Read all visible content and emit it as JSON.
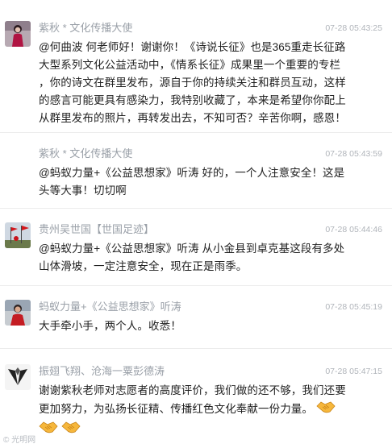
{
  "messages": [
    {
      "name": "紫秋 * 文化传播大使",
      "time": "07-28 05:43:25",
      "avatar": "woman-red-dress-avatar",
      "lines": [
        "@何曲波 何老师好！谢谢你！《诗说长征》也是365重走长征路",
        "大型系列文化公益活动中，《情系长征》成果里一个重要的专栏",
        "，你的诗文在群里发布，源自于你的持续关注和群员互动，这样",
        "的感言可能更具有感染力，我特别收藏了，本来是希望你你配上",
        "从群里发布的照片，再转发出去，不知可否？辛苦你啊，感恩！"
      ]
    },
    {
      "name": "紫秋 * 文化传播大使",
      "time": "07-28 05:43:59",
      "avatar": "none",
      "lines": [
        "@蚂蚁力量+《公益思想家》听涛 好的，一个人注意安全！这是",
        "头等大事！切切啊"
      ]
    },
    {
      "name": "贵州吴世国【世国足迹】",
      "time": "07-28 05:44:46",
      "avatar": "red-flags-avatar",
      "lines": [
        "@蚂蚁力量+《公益思想家》听涛 从小金县到卓克基这段有多处",
        "山体滑坡，一定注意安全，现在正是雨季。"
      ]
    },
    {
      "name": "蚂蚁力量+《公益思想家》听涛",
      "time": "07-28 05:45:19",
      "avatar": "man-red-shirt-avatar",
      "lines": [
        "大手牵小手，两个人。收悉！"
      ]
    },
    {
      "name": "振翅飞翔、沧海一粟彭德涛",
      "time": "07-28 05:47:15",
      "avatar": "black-white-logo-avatar",
      "lines": [
        "谢谢紫秋老师对志愿者的高度评价，我们做的还不够，我们还要",
        "更加努力，为弘扬长征精、传播红色文化奉献一份力量。"
      ],
      "emoji": "handshake-emoji"
    }
  ],
  "watermark": "© 光明网"
}
